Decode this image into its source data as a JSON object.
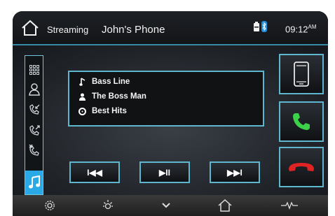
{
  "header": {
    "source": "Streaming",
    "device_name": "John's Phone",
    "time": "09:12",
    "ampm": "AM"
  },
  "sidebar": {
    "items": [
      {
        "icon": "grid-icon"
      },
      {
        "icon": "contacts-icon"
      },
      {
        "icon": "incoming-call-icon"
      },
      {
        "icon": "outgoing-call-icon"
      },
      {
        "icon": "missed-call-icon"
      },
      {
        "icon": "music-note-icon",
        "active": true
      }
    ]
  },
  "track": {
    "song": "Bass Line",
    "artist": "The Boss Man",
    "album": "Best Hits"
  },
  "controls": {
    "prev": "I◀◀",
    "play_pause": "▶II",
    "next": "▶▶I"
  },
  "right_buttons": [
    "phone-icon",
    "answer-call-icon",
    "end-call-icon"
  ],
  "bottom_bar": [
    "settings-icon",
    "brightness-icon",
    "chevron-down-icon",
    "home-icon",
    "audio-wave-icon"
  ],
  "colors": {
    "accent": "#5fb7cf",
    "active": "#2aa9e6",
    "answer": "#3bd24a",
    "end": "#e02424"
  }
}
